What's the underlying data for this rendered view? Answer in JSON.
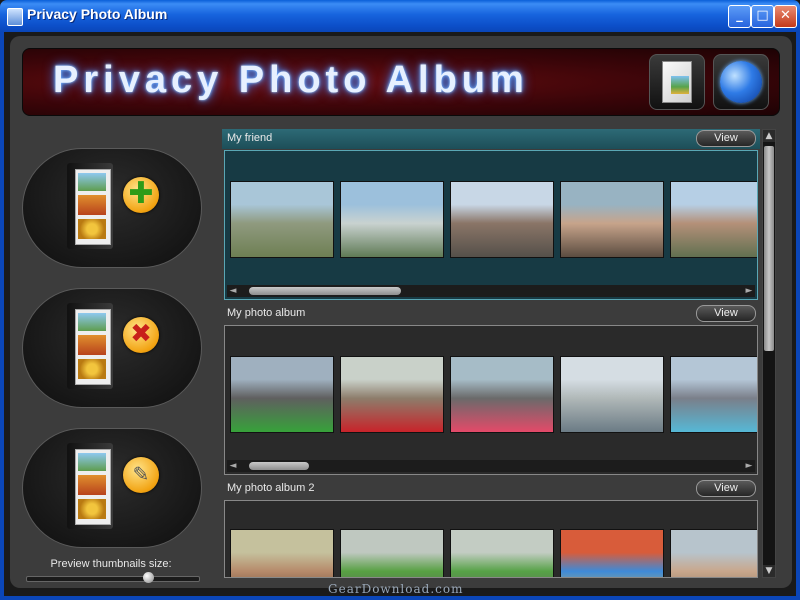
{
  "window": {
    "title": "Privacy Photo Album",
    "min": "_",
    "max": "□",
    "close": "✕"
  },
  "banner": {
    "title": "Privacy Photo Album"
  },
  "sidebar": {
    "preview_label": "Preview thumbnails size:",
    "preview_size": 0.71
  },
  "albums": [
    {
      "name": "My friend",
      "view": "View",
      "selected": true,
      "photos": [
        {
          "icon": "cathedral-photo",
          "colors": [
            "#a9c6d8",
            "#8f9a7f",
            "#6e7f53"
          ]
        },
        {
          "icon": "building-photo",
          "colors": [
            "#9cc0dc",
            "#c9d2d0",
            "#5f7a55"
          ]
        },
        {
          "icon": "street-photo",
          "colors": [
            "#c8d7e6",
            "#8a7567",
            "#55504a"
          ]
        },
        {
          "icon": "man-statue-photo",
          "colors": [
            "#98b3c2",
            "#c7a48b",
            "#5b4c40"
          ]
        },
        {
          "icon": "town-view-photo",
          "colors": [
            "#b6cfe5",
            "#b49079",
            "#617050"
          ]
        }
      ]
    },
    {
      "name": "My photo album",
      "view": "View",
      "selected": false,
      "photos": [
        {
          "icon": "green-beetle-photo",
          "colors": [
            "#9fb0bf",
            "#5f5f5f",
            "#37a23a"
          ]
        },
        {
          "icon": "red-car-photo",
          "colors": [
            "#c9d1c9",
            "#8d7d6b",
            "#c8232a"
          ]
        },
        {
          "icon": "pink-car-photo",
          "colors": [
            "#a6bcc7",
            "#6a6a6a",
            "#e44a69"
          ]
        },
        {
          "icon": "white-car-photo",
          "colors": [
            "#d5dde3",
            "#b0b8b8",
            "#6b7b85"
          ]
        },
        {
          "icon": "blue-car-photo",
          "colors": [
            "#b4c6d6",
            "#7a7f8a",
            "#56b8d6"
          ]
        }
      ]
    },
    {
      "name": "My photo album 2",
      "view": "View",
      "selected": false,
      "photos": [
        {
          "icon": "people-photo",
          "colors": [
            "#c5c19d",
            "#b68a6a",
            "#5a3b2b"
          ]
        },
        {
          "icon": "truck-photo",
          "colors": [
            "#bfc8c0",
            "#58a043",
            "#5a5a5a"
          ]
        },
        {
          "icon": "truck-photo-2",
          "colors": [
            "#c3ccc3",
            "#57a247",
            "#5b5b5b"
          ]
        },
        {
          "icon": "toys-photo",
          "colors": [
            "#d85c3a",
            "#3e8ad8",
            "#efc03c"
          ]
        },
        {
          "icon": "children-photo",
          "colors": [
            "#b7c4cc",
            "#c8a78c",
            "#7e6856"
          ]
        }
      ]
    }
  ],
  "watermark": "GearDownload.com"
}
